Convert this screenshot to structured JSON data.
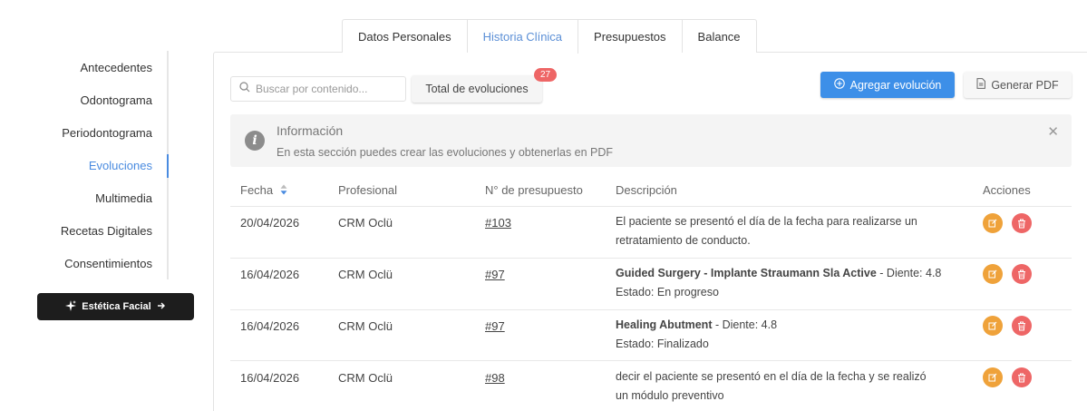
{
  "tabs": [
    {
      "label": "Datos Personales",
      "active": false
    },
    {
      "label": "Historia Clínica",
      "active": true
    },
    {
      "label": "Presupuestos",
      "active": false
    },
    {
      "label": "Balance",
      "active": false
    }
  ],
  "sidebar": {
    "items": [
      {
        "label": "Antecedentes",
        "active": false
      },
      {
        "label": "Odontograma",
        "active": false
      },
      {
        "label": "Periodontograma",
        "active": false
      },
      {
        "label": "Evoluciones",
        "active": true
      },
      {
        "label": "Multimedia",
        "active": false
      },
      {
        "label": "Recetas Digitales",
        "active": false
      },
      {
        "label": "Consentimientos",
        "active": false
      }
    ],
    "facial_button": "Estética Facial"
  },
  "toolbar": {
    "search_placeholder": "Buscar por contenido...",
    "total_label": "Total de evoluciones",
    "total_count": "27",
    "add_label": "Agregar evolución",
    "pdf_label": "Generar PDF"
  },
  "info": {
    "title": "Información",
    "text": "En esta sección puedes crear las evoluciones y obtenerlas en PDF"
  },
  "table": {
    "headers": {
      "fecha": "Fecha",
      "profesional": "Profesional",
      "presupuesto": "N° de presupuesto",
      "descripcion": "Descripción",
      "acciones": "Acciones"
    },
    "rows": [
      {
        "fecha": "20/04/2026",
        "profesional": "CRM Oclü",
        "presupuesto": "#103",
        "desc_bold": "",
        "desc_line1": "El paciente se presentó el día de la fecha para realizarse un",
        "desc_line2": "retratamiento de conducto."
      },
      {
        "fecha": "16/04/2026",
        "profesional": "CRM Oclü",
        "presupuesto": "#97",
        "desc_bold": "Guided Surgery - Implante Straumann Sla Active",
        "desc_line1": " - Diente: 4.8",
        "desc_line2": "Estado: En progreso"
      },
      {
        "fecha": "16/04/2026",
        "profesional": "CRM Oclü",
        "presupuesto": "#97",
        "desc_bold": "Healing Abutment",
        "desc_line1": " - Diente: 4.8",
        "desc_line2": "Estado: Finalizado"
      },
      {
        "fecha": "16/04/2026",
        "profesional": "CRM Oclü",
        "presupuesto": "#98",
        "desc_bold": "",
        "desc_line1": "decir el paciente se presentó en el día de la fecha y se realizó",
        "desc_line2": "un módulo preventivo"
      }
    ]
  },
  "colors": {
    "accent": "#3d8fe8",
    "active_tab": "#5b8fd6",
    "badge": "#ee6666",
    "edit": "#efa23a",
    "delete": "#ee6666"
  }
}
